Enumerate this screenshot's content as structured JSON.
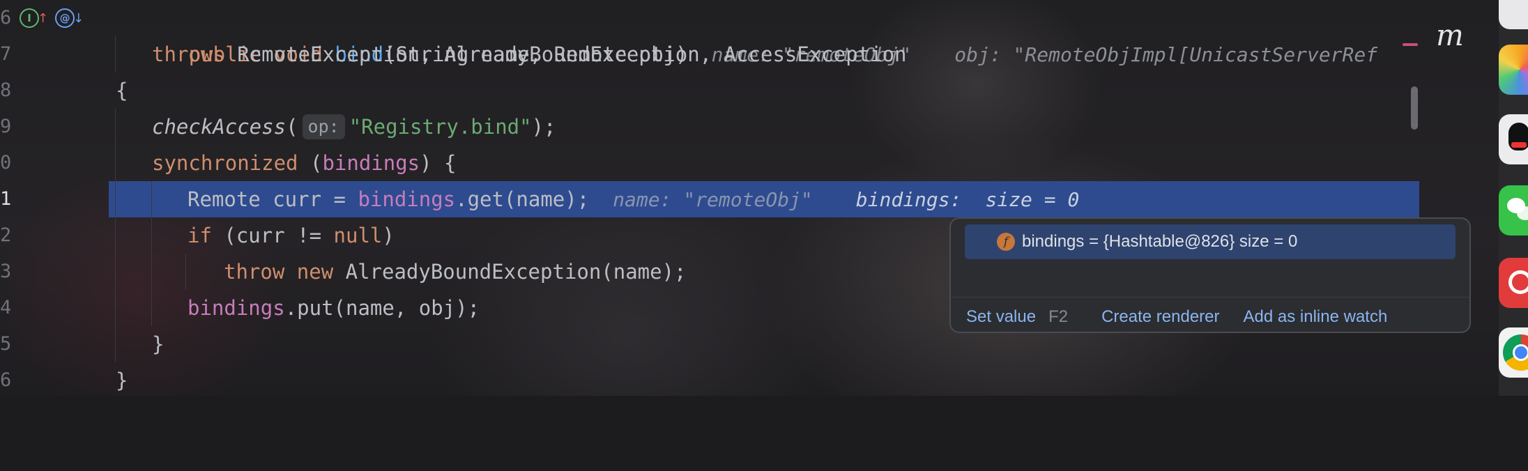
{
  "gutter": [
    "6",
    "7",
    "8",
    "9",
    "0",
    "1",
    "2",
    "3",
    "4",
    "5",
    "6"
  ],
  "lines": {
    "l6": {
      "kw1": "public",
      "kw2": "void",
      "fn": "bind",
      "rest": "(String name, Remote obj)",
      "hint_name": "name: \"remoteObj\"",
      "hint_obj": "obj: \"RemoteObjImpl[UnicastServerRef"
    },
    "l7": {
      "kw": "throws",
      "rest": " RemoteException, AlreadyBoundException, AccessException"
    },
    "l8": {
      "text": "{"
    },
    "l9": {
      "fn": "checkAccess",
      "open": "(",
      "param_hint": "op:",
      "str": "\"Registry.bind\"",
      "close": ");"
    },
    "l10": {
      "kw": "synchronized",
      "open": " (",
      "fld": "bindings",
      "close": ") {"
    },
    "l11": {
      "pre": "Remote curr = ",
      "fld": "bindings",
      "post": ".get(name);",
      "hint_name": "name: \"remoteObj\"",
      "hint_bindings": "bindings:",
      "hint_size": "size = 0"
    },
    "l12": {
      "kw1": "if",
      "mid": " (curr != ",
      "kw2": "null",
      "close": ")"
    },
    "l13": {
      "kw1": "throw",
      "kw2": "new",
      "rest": " AlreadyBoundException(name);"
    },
    "l14": {
      "fld": "bindings",
      "rest": ".put(name, obj);"
    },
    "l15": {
      "text": "}"
    },
    "l16": {
      "text": "}"
    }
  },
  "gutter_icons": {
    "i1": "I",
    "i2": "↑",
    "i3": "@",
    "i4": "↓"
  },
  "side_letter": "m",
  "popup": {
    "field_icon": "f",
    "entry": "bindings = {Hashtable@826}  size = 0",
    "actions": {
      "set_value": "Set value",
      "set_value_shortcut": "F2",
      "create_renderer": "Create renderer",
      "add_inline_watch": "Add as inline watch"
    }
  },
  "colors": {
    "keyword": "#cf8e6d",
    "method": "#56a8f5",
    "string": "#6aab73",
    "field": "#c77dbb",
    "highlight": "#2e4b8f"
  }
}
